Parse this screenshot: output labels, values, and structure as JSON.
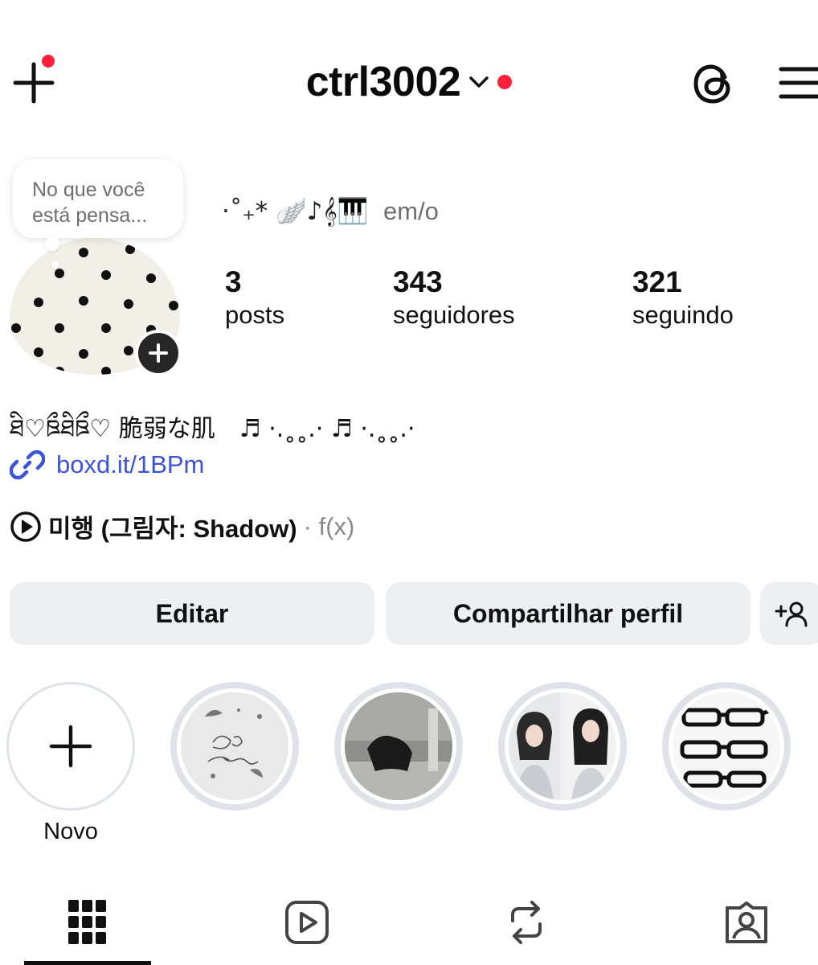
{
  "header": {
    "username": "ctrl3002",
    "colors": {
      "notification_dot": "#ff1f3d"
    }
  },
  "note": {
    "text": "No que você está pensa..."
  },
  "profile": {
    "name_decoration": "·˚₊* 🪽♪𝄞🎹",
    "pronouns": "em/o",
    "stats": [
      {
        "value": "3",
        "label": "posts"
      },
      {
        "value": "343",
        "label": "seguidores"
      },
      {
        "value": "321",
        "label": "seguindo"
      }
    ],
    "bio": "ཐི♡ཋྀཐིཋྀ♡ 脆弱な肌　♬ ·.˳˳.· ♬ ·.˳˳.·",
    "link": "boxd.it/1BPm",
    "music": {
      "title": "미행 (그림자: Shadow)",
      "artist": "· f(x)"
    }
  },
  "actions": {
    "edit": "Editar",
    "share": "Compartilhar perfil"
  },
  "highlights": {
    "new_label": "Novo",
    "items": [
      {
        "icon": "dear-engene-highlight"
      },
      {
        "icon": "dark-photo-highlight"
      },
      {
        "icon": "portrait-highlight"
      },
      {
        "icon": "glasses-highlight"
      }
    ]
  },
  "tabs": [
    {
      "icon": "grid-icon",
      "active": true
    },
    {
      "icon": "reels-icon",
      "active": false
    },
    {
      "icon": "repost-icon",
      "active": false
    },
    {
      "icon": "tagged-icon",
      "active": false
    }
  ],
  "colors": {
    "link": "#3d54d6",
    "button_bg": "#eeeff2",
    "ring": "#dfe2e8"
  }
}
